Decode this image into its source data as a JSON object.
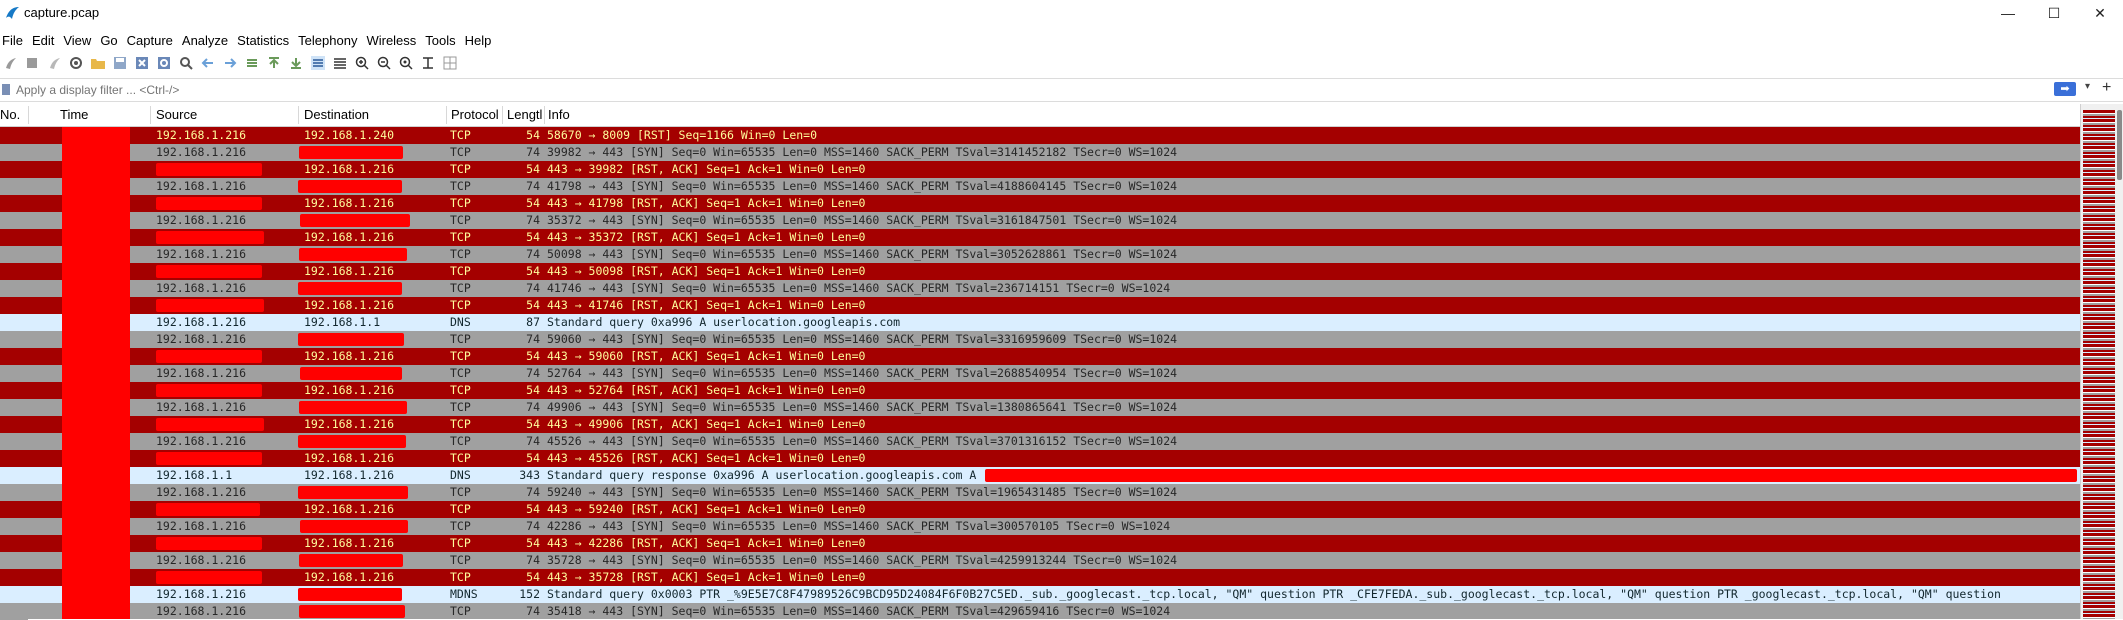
{
  "window": {
    "title": "capture.pcap",
    "minimize": "—",
    "maximize": "☐",
    "close": "✕"
  },
  "menu": [
    "File",
    "Edit",
    "View",
    "Go",
    "Capture",
    "Analyze",
    "Statistics",
    "Telephony",
    "Wireless",
    "Tools",
    "Help"
  ],
  "filter": {
    "placeholder": "Apply a display filter ... <Ctrl-/>",
    "apply_glyph": "➡",
    "dropdown_glyph": "▾",
    "add_glyph": "+"
  },
  "columns": {
    "no": "No.",
    "time": "Time",
    "source": "Source",
    "destination": "Destination",
    "protocol": "Protocol",
    "length": "Lengtl",
    "info": "Info"
  },
  "packets": [
    {
      "style": "dark",
      "src": "192.168.1.216",
      "dst": "192.168.1.240",
      "proto": "TCP",
      "len": "54",
      "info": "58670 → 8009 [RST] Seq=1166 Win=0 Len=0"
    },
    {
      "style": "gray",
      "src": "192.168.1.216",
      "dst": "",
      "proto": "TCP",
      "len": "74",
      "info": "39982 → 443 [SYN] Seq=0 Win=65535 Len=0 MSS=1460 SACK_PERM TSval=3141452182 TSecr=0 WS=1024"
    },
    {
      "style": "dark",
      "src": "",
      "dst": "192.168.1.216",
      "proto": "TCP",
      "len": "54",
      "info": "443 → 39982 [RST, ACK] Seq=1 Ack=1 Win=0 Len=0"
    },
    {
      "style": "gray",
      "src": "192.168.1.216",
      "dst": "",
      "proto": "TCP",
      "len": "74",
      "info": "41798 → 443 [SYN] Seq=0 Win=65535 Len=0 MSS=1460 SACK_PERM TSval=4188604145 TSecr=0 WS=1024"
    },
    {
      "style": "dark",
      "src": "",
      "dst": "192.168.1.216",
      "proto": "TCP",
      "len": "54",
      "info": "443 → 41798 [RST, ACK] Seq=1 Ack=1 Win=0 Len=0"
    },
    {
      "style": "gray",
      "src": "192.168.1.216",
      "dst": "",
      "proto": "TCP",
      "len": "74",
      "info": "35372 → 443 [SYN] Seq=0 Win=65535 Len=0 MSS=1460 SACK_PERM TSval=3161847501 TSecr=0 WS=1024"
    },
    {
      "style": "dark",
      "src": "",
      "dst": "192.168.1.216",
      "proto": "TCP",
      "len": "54",
      "info": "443 → 35372 [RST, ACK] Seq=1 Ack=1 Win=0 Len=0"
    },
    {
      "style": "gray",
      "src": "192.168.1.216",
      "dst": "",
      "proto": "TCP",
      "len": "74",
      "info": "50098 → 443 [SYN] Seq=0 Win=65535 Len=0 MSS=1460 SACK_PERM TSval=3052628861 TSecr=0 WS=1024"
    },
    {
      "style": "dark",
      "src": "",
      "dst": "192.168.1.216",
      "proto": "TCP",
      "len": "54",
      "info": "443 → 50098 [RST, ACK] Seq=1 Ack=1 Win=0 Len=0"
    },
    {
      "style": "gray",
      "src": "192.168.1.216",
      "dst": "",
      "proto": "TCP",
      "len": "74",
      "info": "41746 → 443 [SYN] Seq=0 Win=65535 Len=0 MSS=1460 SACK_PERM TSval=236714151 TSecr=0 WS=1024"
    },
    {
      "style": "dark",
      "src": "",
      "dst": "192.168.1.216",
      "proto": "TCP",
      "len": "54",
      "info": "443 → 41746 [RST, ACK] Seq=1 Ack=1 Win=0 Len=0"
    },
    {
      "style": "dns",
      "src": "192.168.1.216",
      "dst": "192.168.1.1",
      "proto": "DNS",
      "len": "87",
      "info": "Standard query 0xa996 A userlocation.googleapis.com"
    },
    {
      "style": "gray",
      "src": "192.168.1.216",
      "dst": "",
      "proto": "TCP",
      "len": "74",
      "info": "59060 → 443 [SYN] Seq=0 Win=65535 Len=0 MSS=1460 SACK_PERM TSval=3316959609 TSecr=0 WS=1024"
    },
    {
      "style": "dark",
      "src": "",
      "dst": "192.168.1.216",
      "proto": "TCP",
      "len": "54",
      "info": "443 → 59060 [RST, ACK] Seq=1 Ack=1 Win=0 Len=0"
    },
    {
      "style": "gray",
      "src": "192.168.1.216",
      "dst": "",
      "proto": "TCP",
      "len": "74",
      "info": "52764 → 443 [SYN] Seq=0 Win=65535 Len=0 MSS=1460 SACK_PERM TSval=2688540954 TSecr=0 WS=1024"
    },
    {
      "style": "dark",
      "src": "",
      "dst": "192.168.1.216",
      "proto": "TCP",
      "len": "54",
      "info": "443 → 52764 [RST, ACK] Seq=1 Ack=1 Win=0 Len=0"
    },
    {
      "style": "gray",
      "src": "192.168.1.216",
      "dst": "",
      "proto": "TCP",
      "len": "74",
      "info": "49906 → 443 [SYN] Seq=0 Win=65535 Len=0 MSS=1460 SACK_PERM TSval=1380865641 TSecr=0 WS=1024"
    },
    {
      "style": "dark",
      "src": "",
      "dst": "192.168.1.216",
      "proto": "TCP",
      "len": "54",
      "info": "443 → 49906 [RST, ACK] Seq=1 Ack=1 Win=0 Len=0"
    },
    {
      "style": "gray",
      "src": "192.168.1.216",
      "dst": "",
      "proto": "TCP",
      "len": "74",
      "info": "45526 → 443 [SYN] Seq=0 Win=65535 Len=0 MSS=1460 SACK_PERM TSval=3701316152 TSecr=0 WS=1024"
    },
    {
      "style": "dark",
      "src": "",
      "dst": "192.168.1.216",
      "proto": "TCP",
      "len": "54",
      "info": "443 → 45526 [RST, ACK] Seq=1 Ack=1 Win=0 Len=0"
    },
    {
      "style": "dns",
      "src": "192.168.1.1",
      "dst": "192.168.1.216",
      "proto": "DNS",
      "len": "343",
      "info": "Standard query response 0xa996 A userlocation.googleapis.com A"
    },
    {
      "style": "gray",
      "src": "192.168.1.216",
      "dst": "",
      "proto": "TCP",
      "len": "74",
      "info": "59240 → 443 [SYN] Seq=0 Win=65535 Len=0 MSS=1460 SACK_PERM TSval=1965431485 TSecr=0 WS=1024"
    },
    {
      "style": "dark",
      "src": "",
      "dst": "192.168.1.216",
      "proto": "TCP",
      "len": "54",
      "info": "443 → 59240 [RST, ACK] Seq=1 Ack=1 Win=0 Len=0"
    },
    {
      "style": "gray",
      "src": "192.168.1.216",
      "dst": "",
      "proto": "TCP",
      "len": "74",
      "info": "42286 → 443 [SYN] Seq=0 Win=65535 Len=0 MSS=1460 SACK_PERM TSval=300570105 TSecr=0 WS=1024"
    },
    {
      "style": "dark",
      "src": "",
      "dst": "192.168.1.216",
      "proto": "TCP",
      "len": "54",
      "info": "443 → 42286 [RST, ACK] Seq=1 Ack=1 Win=0 Len=0"
    },
    {
      "style": "gray",
      "src": "192.168.1.216",
      "dst": "",
      "proto": "TCP",
      "len": "74",
      "info": "35728 → 443 [SYN] Seq=0 Win=65535 Len=0 MSS=1460 SACK_PERM TSval=4259913244 TSecr=0 WS=1024"
    },
    {
      "style": "dark",
      "src": "",
      "dst": "192.168.1.216",
      "proto": "TCP",
      "len": "54",
      "info": "443 → 35728 [RST, ACK] Seq=1 Ack=1 Win=0 Len=0"
    },
    {
      "style": "dns",
      "src": "192.168.1.216",
      "dst": "",
      "proto": "MDNS",
      "len": "152",
      "info": "Standard query 0x0003 PTR _%9E5E7C8F47989526C9BCD95D24084F6F0B27C5ED._sub._googlecast._tcp.local, \"QM\" question PTR _CFE7FEDA._sub._googlecast._tcp.local, \"QM\" question PTR _googlecast._tcp.local, \"QM\" question"
    },
    {
      "style": "gray",
      "src": "192.168.1.216",
      "dst": "",
      "proto": "TCP",
      "len": "74",
      "info": "35418 → 443 [SYN] Seq=0 Win=65535 Len=0 MSS=1460 SACK_PERM TSval=429659416 TSecr=0 WS=1024"
    }
  ],
  "colors": {
    "rst_bg": "#a40000",
    "rst_fg": "#fffc9c",
    "syn_bg": "#a0a0a0",
    "dns_bg": "#daeeff",
    "redaction": "#ff0000"
  }
}
